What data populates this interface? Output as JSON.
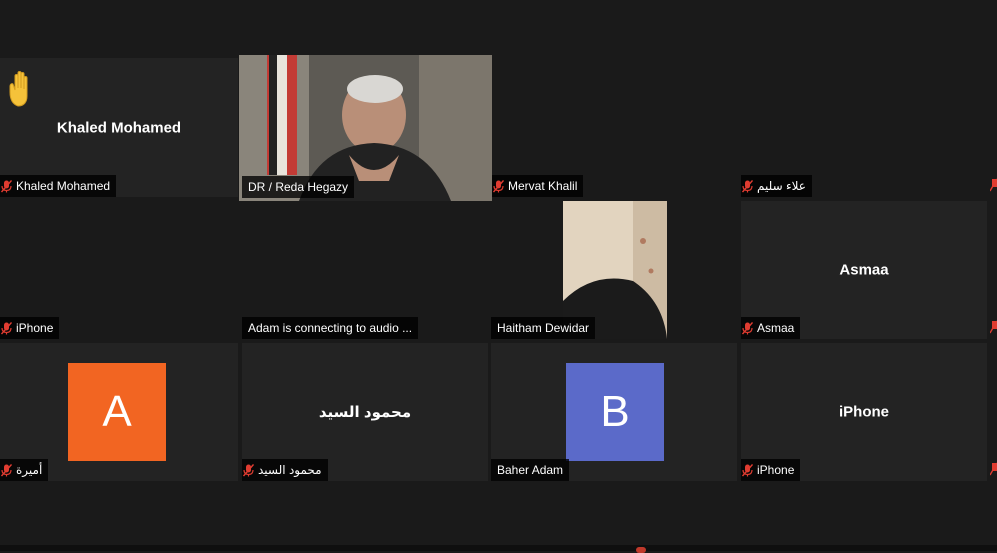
{
  "participants": [
    {
      "name": "Khaled Mohamed",
      "label": "Khaled Mohamed",
      "muted": true,
      "raised_hand": true,
      "display": "Khaled Mohamed"
    },
    {
      "name": "DR / Reda Hegazy",
      "label": "DR / Reda Hegazy",
      "muted": false,
      "video": true,
      "active_speaker": true
    },
    {
      "name": "Mervat Khalil",
      "label": "Mervat Khalil",
      "muted": true
    },
    {
      "name": "علاء سليم",
      "label": "علاء سليم",
      "muted": true
    },
    {
      "name": "iPhone",
      "label": "iPhone",
      "muted": true
    },
    {
      "name": "Adam is connecting to audio",
      "label": "Adam is connecting to audio ...",
      "muted": false
    },
    {
      "name": "Haitham Dewidar",
      "label": "Haitham Dewidar",
      "muted": false,
      "video": true
    },
    {
      "name": "Asmaa",
      "label": "Asmaa",
      "muted": true,
      "display": "Asmaa"
    },
    {
      "name": "أميرة",
      "label": "أميرة",
      "muted": true,
      "avatar_letter": "A",
      "avatar_color": "#f26522"
    },
    {
      "name": "محمود السيد",
      "label": "محمود السيد",
      "muted": true,
      "display": "محمود السيد"
    },
    {
      "name": "Baher Adam",
      "label": "Baher Adam",
      "muted": false,
      "avatar_letter": "B",
      "avatar_color": "#5b6ac9"
    },
    {
      "name": "iPhone",
      "label": "iPhone",
      "muted": true,
      "display": "iPhone"
    }
  ],
  "colors": {
    "background": "#1a1a1a",
    "tile": "#232323",
    "active_border": "#c8e67a",
    "muted_icon": "#e03c31"
  }
}
